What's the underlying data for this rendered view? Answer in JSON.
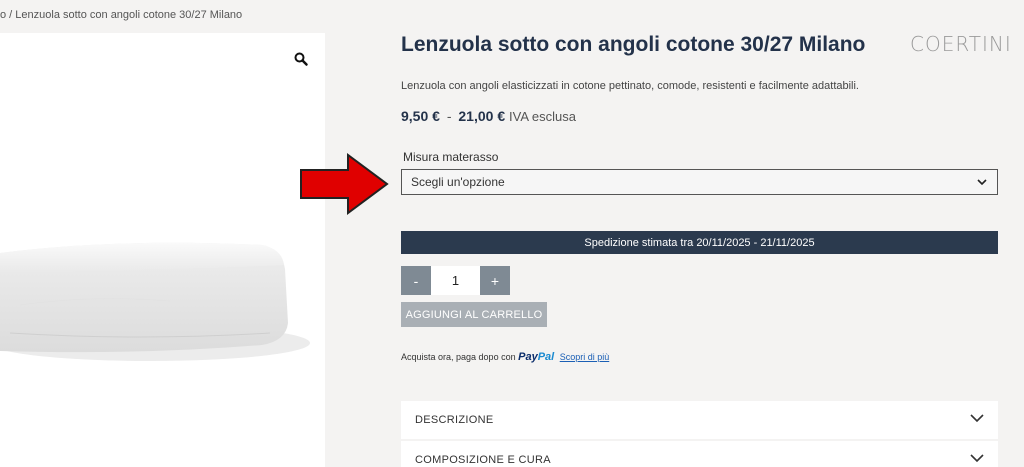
{
  "breadcrumb": {
    "text": "o / Lenzuola sotto con angoli cotone 30/27 Milano"
  },
  "brand": {
    "logo_text": "COERTINI"
  },
  "product": {
    "title": "Lenzuola sotto con angoli cotone 30/27 Milano",
    "description": "Lenzuola con angoli elasticizzati in cotone pettinato, comode, resistenti e facilmente adattabili.",
    "price_min": "9,50 €",
    "price_separator": "-",
    "price_max": "21,00 €",
    "vat_note": "IVA esclusa"
  },
  "size": {
    "label": "Misura materasso",
    "selected": "Scegli un'opzione"
  },
  "shipping": {
    "text": "Spedizione stimata tra 20/11/2025 - 21/11/2025"
  },
  "quantity": {
    "minus": "-",
    "value": "1",
    "plus": "+"
  },
  "cart": {
    "add_label": "AGGIUNGI AL CARRELLO"
  },
  "paypal": {
    "text": "Acquista ora, paga dopo con",
    "logo_pay": "Pay",
    "logo_pal": "Pal",
    "link": "Scopri di più"
  },
  "accordions": [
    {
      "label": "DESCRIZIONE"
    },
    {
      "label": "COMPOSIZIONE E CURA"
    }
  ],
  "colors": {
    "title": "#23324a",
    "shipping_bar": "#2b3a4e",
    "arrow": "#e00000",
    "button": "#a9afb5",
    "qty_button": "#7f8a94"
  },
  "icons": {
    "zoom": "magnifier-icon",
    "select": "chevron-down-icon",
    "accordion": "chevron-down-icon",
    "annotation": "red-arrow-icon"
  }
}
